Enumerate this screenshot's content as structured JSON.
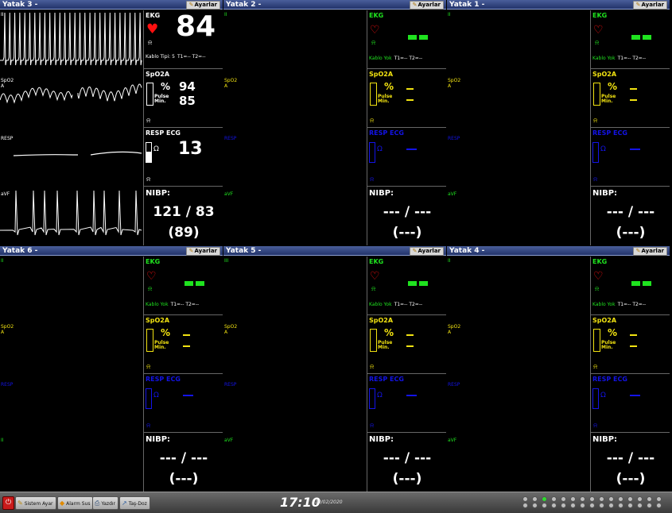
{
  "settings_label": "Ayarlar",
  "colors": {
    "ekg": "#1fe31f",
    "spo2": "#f2e311",
    "resp": "#1313e8",
    "nibp": "#ffffff",
    "active": "#ffffff",
    "alarm": "#ff1010"
  },
  "beds": [
    {
      "title": "Yatak 3 -",
      "active": true,
      "waves": [
        {
          "label": "II",
          "label2": ""
        },
        {
          "label": "SpO2",
          "label2": "A"
        },
        {
          "label": "RESP",
          "label2": ""
        },
        {
          "label": "aVF",
          "label2": ""
        }
      ],
      "ekg": {
        "title": "EKG",
        "value": "84",
        "cable": "Kablo Tipi: 5",
        "t1t2": "T1=-- T2=--"
      },
      "spo2": {
        "title": "SpO2A",
        "pct": "%",
        "pulse": "Pulse",
        "min": "Min.",
        "value": "94",
        "pulse_value": "85"
      },
      "resp": {
        "title": "RESP ECG",
        "value": "13"
      },
      "nibp": {
        "title": "NIBP:",
        "value": "121 / 83",
        "mean": "(89)"
      }
    },
    {
      "title": "Yatak 2 -",
      "active": false,
      "waves": [
        {
          "label": "II",
          "label2": ""
        },
        {
          "label": "SpO2",
          "label2": "A"
        },
        {
          "label": "RESP",
          "label2": ""
        },
        {
          "label": "aVF",
          "label2": ""
        }
      ],
      "ekg": {
        "title": "EKG",
        "value": "",
        "cable": "Kablo Yok",
        "t1t2": "T1=-- T2=--"
      },
      "spo2": {
        "title": "SpO2A",
        "pct": "%",
        "pulse": "Pulse",
        "min": "Min.",
        "value": "",
        "pulse_value": ""
      },
      "resp": {
        "title": "RESP ECG",
        "value": ""
      },
      "nibp": {
        "title": "NIBP:",
        "value": "--- / ---",
        "mean": "(---)"
      }
    },
    {
      "title": "Yatak 1 -",
      "active": false,
      "waves": [
        {
          "label": "II",
          "label2": ""
        },
        {
          "label": "SpO2",
          "label2": "A"
        },
        {
          "label": "RESP",
          "label2": ""
        },
        {
          "label": "aVF",
          "label2": ""
        }
      ],
      "ekg": {
        "title": "EKG",
        "value": "",
        "cable": "Kablo Yok",
        "t1t2": "T1=-- T2=--"
      },
      "spo2": {
        "title": "SpO2A",
        "pct": "%",
        "pulse": "Pulse",
        "min": "Min.",
        "value": "",
        "pulse_value": ""
      },
      "resp": {
        "title": "RESP ECG",
        "value": ""
      },
      "nibp": {
        "title": "NIBP:",
        "value": "--- / ---",
        "mean": "(---)"
      }
    },
    {
      "title": "Yatak 6 -",
      "active": false,
      "waves": [
        {
          "label": "II",
          "label2": ""
        },
        {
          "label": "SpO2",
          "label2": "A"
        },
        {
          "label": "RESP",
          "label2": ""
        },
        {
          "label": "II",
          "label2": ""
        }
      ],
      "ekg": {
        "title": "EKG",
        "value": "",
        "cable": "Kablo Yok",
        "t1t2": "T1=-- T2=--"
      },
      "spo2": {
        "title": "SpO2A",
        "pct": "%",
        "pulse": "Pulse",
        "min": "Min.",
        "value": "",
        "pulse_value": ""
      },
      "resp": {
        "title": "RESP ECG",
        "value": ""
      },
      "nibp": {
        "title": "NIBP:",
        "value": "--- / ---",
        "mean": "(---)"
      }
    },
    {
      "title": "Yatak 5 -",
      "active": false,
      "waves": [
        {
          "label": "III",
          "label2": ""
        },
        {
          "label": "SpO2",
          "label2": "A"
        },
        {
          "label": "RESP",
          "label2": ""
        },
        {
          "label": "aVF",
          "label2": ""
        }
      ],
      "ekg": {
        "title": "EKG",
        "value": "",
        "cable": "Kablo Yok",
        "t1t2": "T1=-- T2=--"
      },
      "spo2": {
        "title": "SpO2A",
        "pct": "%",
        "pulse": "Pulse",
        "min": "Min.",
        "value": "",
        "pulse_value": ""
      },
      "resp": {
        "title": "RESP ECG",
        "value": ""
      },
      "nibp": {
        "title": "NIBP:",
        "value": "--- / ---",
        "mean": "(---)"
      }
    },
    {
      "title": "Yatak 4 -",
      "active": false,
      "waves": [
        {
          "label": "II",
          "label2": ""
        },
        {
          "label": "SpO2",
          "label2": "A"
        },
        {
          "label": "RESP",
          "label2": ""
        },
        {
          "label": "aVF",
          "label2": ""
        }
      ],
      "ekg": {
        "title": "EKG",
        "value": "",
        "cable": "Kablo Yok",
        "t1t2": "T1=-- T2=--"
      },
      "spo2": {
        "title": "SpO2A",
        "pct": "%",
        "pulse": "Pulse",
        "min": "Min.",
        "value": "",
        "pulse_value": ""
      },
      "resp": {
        "title": "RESP ECG",
        "value": ""
      },
      "nibp": {
        "title": "NIBP:",
        "value": "--- / ---",
        "mean": "(---)"
      }
    }
  ],
  "taskbar": {
    "buttons": [
      {
        "label": "Sistem Ayar",
        "icon": "wrench-icon"
      },
      {
        "label": "Alarm Sus",
        "icon": "alarm-mute-icon"
      },
      {
        "label": "Yazdır",
        "icon": "printer-icon"
      },
      {
        "label": "Taş-Doz",
        "icon": "syringe-icon"
      }
    ],
    "time": "17:10",
    "date": "10/02/2020"
  }
}
